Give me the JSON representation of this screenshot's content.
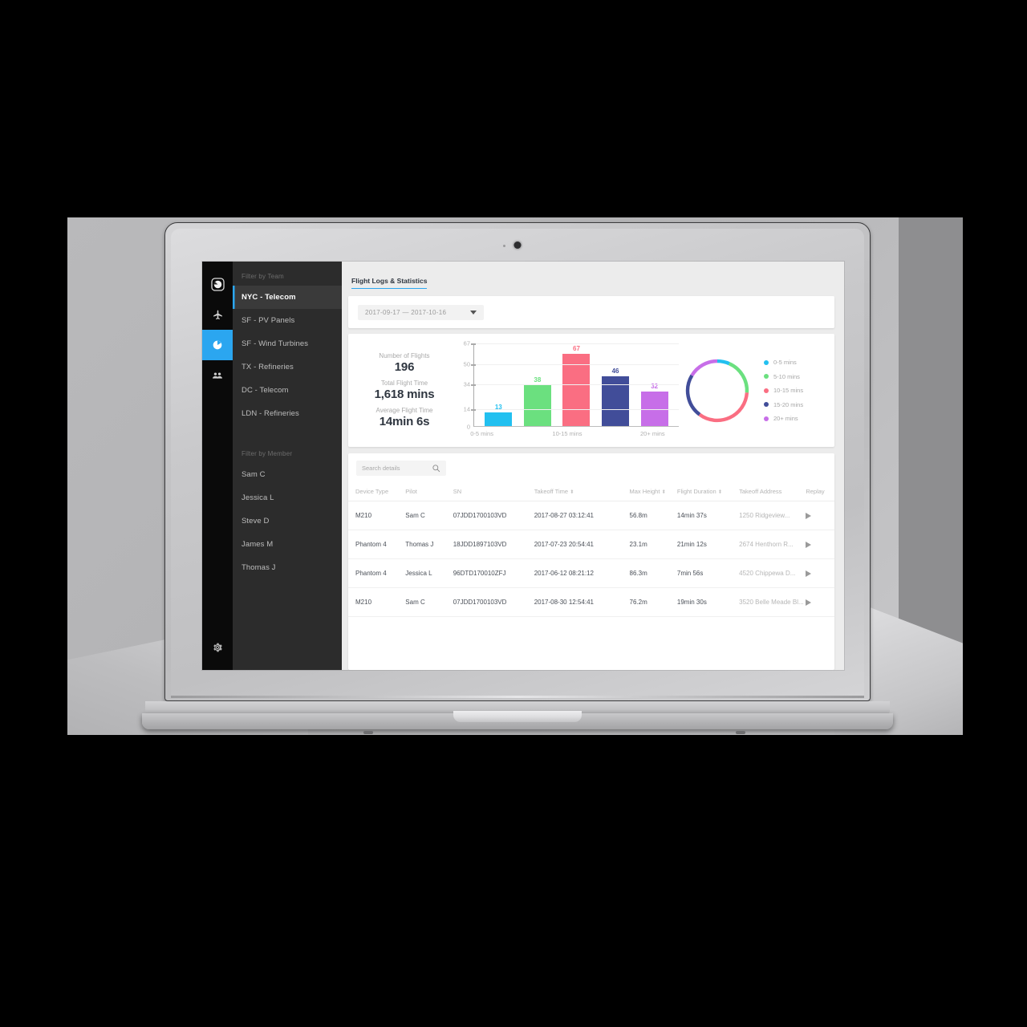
{
  "app": {
    "rail": [
      {
        "name": "logo-icon",
        "label": "Logo"
      },
      {
        "name": "flights-icon",
        "label": "Flights"
      },
      {
        "name": "statistics-icon",
        "label": "Statistics"
      },
      {
        "name": "team-icon",
        "label": "Team"
      },
      {
        "name": "settings-icon",
        "label": "Settings"
      }
    ],
    "filters": {
      "team_header": "Filter by Team",
      "teams": [
        {
          "label": "NYC - Telecom",
          "selected": true
        },
        {
          "label": "SF - PV Panels",
          "selected": false
        },
        {
          "label": "SF - Wind Turbines",
          "selected": false
        },
        {
          "label": "TX - Refineries",
          "selected": false
        },
        {
          "label": "DC - Telecom",
          "selected": false
        },
        {
          "label": "LDN - Refineries",
          "selected": false
        }
      ],
      "member_header": "Filter by Member",
      "members": [
        "Sam C",
        "Jessica L",
        "Steve D",
        "James M",
        "Thomas J"
      ]
    },
    "tab": {
      "label": "Flight Logs & Statistics"
    },
    "daterange": {
      "value": "2017-09-17  —  2017-10-16"
    },
    "kpis": [
      {
        "label": "Number of Flights",
        "value": "196"
      },
      {
        "label": "Total Flight Time",
        "value": "1,618 mins"
      },
      {
        "label": "Average Flight Time",
        "value": "14min 6s"
      }
    ],
    "search": {
      "placeholder": "Search details",
      "value": "",
      "icon": "search-icon"
    },
    "table": {
      "columns": [
        {
          "label": "Device Type",
          "sortable": false
        },
        {
          "label": "Pilot",
          "sortable": false
        },
        {
          "label": "SN",
          "sortable": false
        },
        {
          "label": "Takeoff Time",
          "sortable": true
        },
        {
          "label": "Max Height",
          "sortable": true
        },
        {
          "label": "Flight Duration",
          "sortable": true
        },
        {
          "label": "Takeoff Address",
          "sortable": false
        },
        {
          "label": "Replay",
          "sortable": false
        }
      ],
      "rows": [
        {
          "device": "M210",
          "pilot": "Sam C",
          "sn": "07JDD1700103VD",
          "takeoff": "2017-08-27 03:12:41",
          "height": "56.8m",
          "duration": "14min 37s",
          "address": "1250 Ridgeview...",
          "replay": "play-icon"
        },
        {
          "device": "Phantom 4",
          "pilot": "Thomas J",
          "sn": "18JDD1897103VD",
          "takeoff": "2017-07-23 20:54:41",
          "height": "23.1m",
          "duration": "21min 12s",
          "address": "2674 Henthorn R...",
          "replay": "play-icon"
        },
        {
          "device": "Phantom 4",
          "pilot": "Jessica L",
          "sn": "96DTD170010ZFJ",
          "takeoff": "2017-06-12 08:21:12",
          "height": "86.3m",
          "duration": "7min 56s",
          "address": "4520 Chippewa D...",
          "replay": "play-icon"
        },
        {
          "device": "M210",
          "pilot": "Sam C",
          "sn": "07JDD1700103VD",
          "takeoff": "2017-08-30 12:54:41",
          "height": "76.2m",
          "duration": "19min 30s",
          "address": "3520 Belle Meade Bl...",
          "replay": "play-icon"
        }
      ]
    },
    "colors": {
      "accent": "#2ba6f0",
      "series": [
        "#22c0f0",
        "#6be07f",
        "#fa6e82",
        "#414d99",
        "#c76ee8"
      ]
    }
  },
  "chart_data": [
    {
      "type": "bar",
      "title": "",
      "xlabel": "",
      "ylabel": "",
      "categories": [
        "0-5 mins",
        "5-10 mins",
        "10-15 mins",
        "15-20 mins",
        "20+ mins"
      ],
      "visible_tick_labels": [
        "0-5 mins",
        "10-15 mins",
        "20+ mins"
      ],
      "values": [
        13,
        38,
        67,
        46,
        32
      ],
      "data_labels": [
        "13",
        "38",
        "67",
        "46",
        "32"
      ],
      "yticks": [
        0,
        14,
        34,
        50,
        67
      ],
      "ylim": [
        0,
        67
      ],
      "grid": true,
      "legend": false,
      "colors": [
        "#22c0f0",
        "#6be07f",
        "#fa6e82",
        "#414d99",
        "#c76ee8"
      ]
    },
    {
      "type": "pie",
      "variant": "donut",
      "title": "",
      "labels": [
        "0-5 mins",
        "5-10 mins",
        "10-15 mins",
        "15-20 mins",
        "20+ mins"
      ],
      "values": [
        13,
        38,
        67,
        46,
        32
      ],
      "total": 196,
      "legend": true,
      "legend_position": "right",
      "colors": [
        "#22c0f0",
        "#6be07f",
        "#fa6e82",
        "#414d99",
        "#c76ee8"
      ]
    }
  ]
}
